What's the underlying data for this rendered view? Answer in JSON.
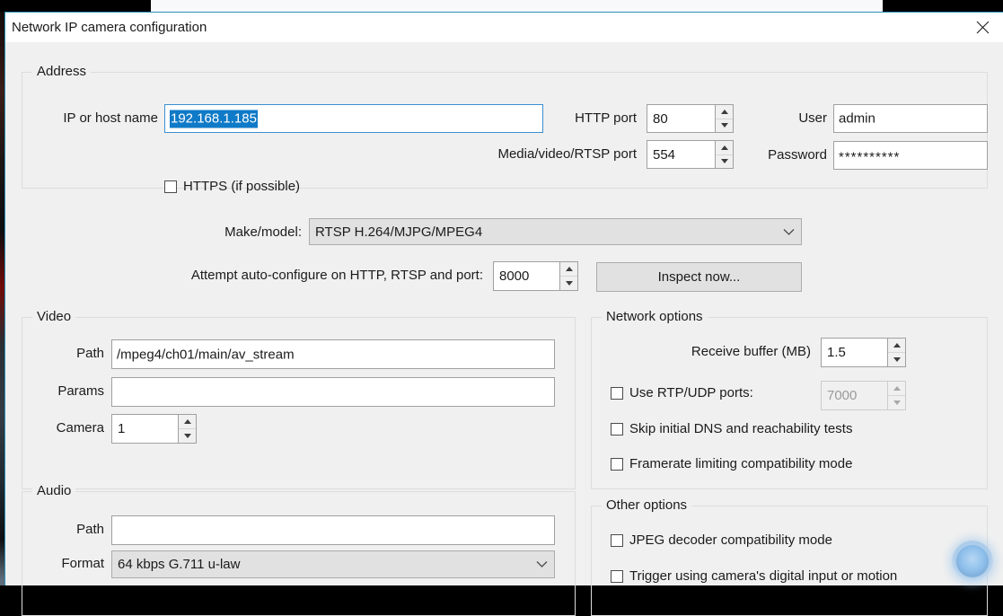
{
  "window": {
    "title": "Network IP camera configuration",
    "close_icon": "close-icon"
  },
  "address": {
    "group_title": "Address",
    "ip_label": "IP or host name",
    "ip_value": "192.168.1.185",
    "https_label": "HTTPS (if possible)",
    "https_checked": false,
    "http_port_label": "HTTP port",
    "http_port_value": "80",
    "rtsp_port_label": "Media/video/RTSP port",
    "rtsp_port_value": "554",
    "user_label": "User",
    "user_value": "admin",
    "password_label": "Password",
    "password_value": "**********"
  },
  "model": {
    "make_model_label": "Make/model:",
    "make_model_value": "RTSP H.264/MJPG/MPEG4",
    "autoconfig_label": "Attempt auto-configure on HTTP, RTSP and port:",
    "autoconfig_port": "8000",
    "inspect_button": "Inspect now..."
  },
  "video": {
    "group_title": "Video",
    "path_label": "Path",
    "path_value": "/mpeg4/ch01/main/av_stream",
    "params_label": "Params",
    "params_value": "",
    "camera_label": "Camera",
    "camera_value": "1"
  },
  "audio": {
    "group_title": "Audio",
    "path_label": "Path",
    "path_value": "",
    "format_label": "Format",
    "format_value": "64 kbps G.711 u-law"
  },
  "network_options": {
    "group_title": "Network options",
    "receive_buffer_label": "Receive buffer (MB)",
    "receive_buffer_value": "1.5",
    "rtp_udp_label": "Use RTP/UDP ports:",
    "rtp_udp_checked": false,
    "rtp_udp_port_value": "7000",
    "rtp_udp_port_disabled": true,
    "skip_dns_label": "Skip initial DNS and reachability tests",
    "skip_dns_checked": false,
    "framerate_label": "Framerate limiting compatibility mode",
    "framerate_checked": false
  },
  "other_options": {
    "group_title": "Other options",
    "jpeg_label": "JPEG decoder compatibility mode",
    "jpeg_checked": false,
    "trigger_label": "Trigger using camera's digital input or motion",
    "trigger_checked": false
  },
  "colors": {
    "dialog_bg": "#f0f0f0",
    "selection_blue": "#0f7ac7",
    "focus_border": "#3c8fd0",
    "window_border": "#2a8fb5",
    "click_indicator": "#87bceb"
  }
}
